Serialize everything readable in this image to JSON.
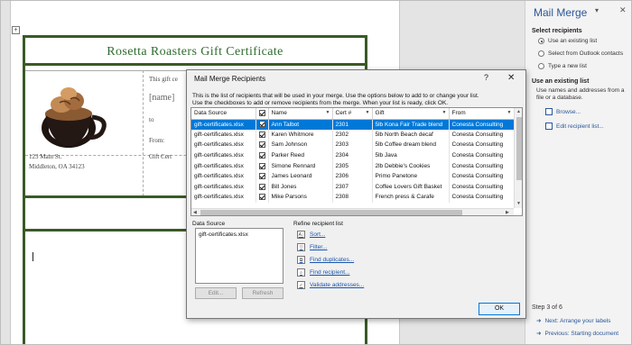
{
  "document": {
    "certificate_title": "Rosetta Roasters Gift Certificate",
    "text_this_gift": "This gift ce",
    "field_name": "[name]",
    "text_to": "to",
    "text_from": "From:",
    "address_line1": "123 Main St.",
    "address_line2": "Middleton, OA 34123",
    "text_gift_cert": "Gift Cert"
  },
  "pane": {
    "title": "Mail Merge",
    "caret": "▾",
    "close": "✕",
    "section_select": "Select recipients",
    "options": [
      {
        "label": "Use an existing list",
        "selected": true
      },
      {
        "label": "Select from Outlook contacts",
        "selected": false
      },
      {
        "label": "Type a new list",
        "selected": false
      }
    ],
    "section_existing": "Use an existing list",
    "existing_desc": "Use names and addresses from a file or a database.",
    "link_browse": "Browse...",
    "link_edit": "Edit recipient list...",
    "step": "Step 3 of 6",
    "next": "Next: Arrange your labels",
    "previous": "Previous: Starting document"
  },
  "dialog": {
    "title": "Mail Merge Recipients",
    "help": "?",
    "close": "✕",
    "desc_line1": "This is the list of recipients that will be used in your merge.  Use the options below to add to or change your list.",
    "desc_line2": "Use the checkboxes to add or remove recipients from the merge.  When your list is ready, click OK.",
    "columns": [
      "Data Source",
      "",
      "Name",
      "Cert #",
      "Gift",
      "From"
    ],
    "rows": [
      {
        "source": "gift-certificates.xlsx",
        "checked": true,
        "name": "Ann Talbot",
        "cert": "2301",
        "gift": "5lb Kona Fair Trade blend",
        "from": "Conesta Consulting",
        "selected": true
      },
      {
        "source": "gift-certificates.xlsx",
        "checked": true,
        "name": "Karen Whitmore",
        "cert": "2302",
        "gift": "5lb North Beach decaf",
        "from": "Conesta Consulting",
        "selected": false
      },
      {
        "source": "gift-certificates.xlsx",
        "checked": true,
        "name": "Sam Johnson",
        "cert": "2303",
        "gift": "5lb Coffee dream blend",
        "from": "Conesta Consulting",
        "selected": false
      },
      {
        "source": "gift-certificates.xlsx",
        "checked": true,
        "name": "Parker Reed",
        "cert": "2304",
        "gift": "5lb Java",
        "from": "Conesta Consulting",
        "selected": false
      },
      {
        "source": "gift-certificates.xlsx",
        "checked": true,
        "name": "Simone Rennard",
        "cert": "2305",
        "gift": "2lb Debbie's Cookies",
        "from": "Conesta Consulting",
        "selected": false
      },
      {
        "source": "gift-certificates.xlsx",
        "checked": true,
        "name": "James Leonard",
        "cert": "2306",
        "gift": "Primo Panetone",
        "from": "Conesta Consulting",
        "selected": false
      },
      {
        "source": "gift-certificates.xlsx",
        "checked": true,
        "name": "Bill Jones",
        "cert": "2307",
        "gift": "Coffee Lovers Gift Basket",
        "from": "Conesta Consulting",
        "selected": false
      },
      {
        "source": "gift-certificates.xlsx",
        "checked": true,
        "name": "Mike Parsons",
        "cert": "2308",
        "gift": "French press & Carafe",
        "from": "Conesta Consulting",
        "selected": false
      }
    ],
    "data_source_label": "Data Source",
    "data_source_item": "gift-certificates.xlsx",
    "edit_label": "Edit...",
    "refresh_label": "Refresh",
    "refine_label": "Refine recipient list",
    "refine_links": [
      {
        "label": "Sort...",
        "icon": "sort-icon",
        "glyph": "A↓"
      },
      {
        "label": "Filter...",
        "icon": "filter-icon",
        "glyph": "▽"
      },
      {
        "label": "Find duplicates...",
        "icon": "duplicates-icon",
        "glyph": "⧉"
      },
      {
        "label": "Find recipient...",
        "icon": "find-recipient-icon",
        "glyph": "⌕"
      },
      {
        "label": "Validate addresses...",
        "icon": "validate-icon",
        "glyph": "✓"
      }
    ],
    "ok_label": "OK"
  },
  "colors": {
    "accent": "#2b5797",
    "selection": "#0078d7",
    "cert_border": "#3a5a26",
    "cert_title": "#2e6b2e"
  }
}
